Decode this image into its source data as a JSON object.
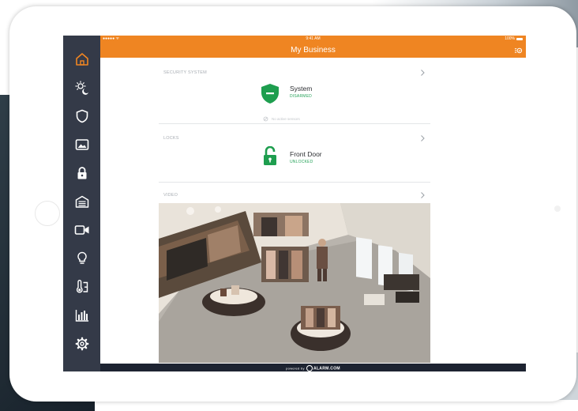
{
  "status_bar": {
    "signal": "●●●●● ᯤ",
    "time": "9:41 AM",
    "battery": "100%"
  },
  "header": {
    "title": "My Business",
    "action_icon": "scene-settings-icon"
  },
  "sidebar": {
    "items": [
      {
        "name": "home",
        "icon": "home-icon",
        "active": true
      },
      {
        "name": "scenes",
        "icon": "sun-moon-icon"
      },
      {
        "name": "security",
        "icon": "shield-icon"
      },
      {
        "name": "images",
        "icon": "image-icon"
      },
      {
        "name": "locks",
        "icon": "lock-icon"
      },
      {
        "name": "garage",
        "icon": "garage-icon"
      },
      {
        "name": "video",
        "icon": "video-camera-icon"
      },
      {
        "name": "lights",
        "icon": "light-bulb-icon"
      },
      {
        "name": "thermostat",
        "icon": "thermostat-icon"
      },
      {
        "name": "energy",
        "icon": "bar-chart-icon"
      },
      {
        "name": "settings",
        "icon": "gear-icon"
      }
    ]
  },
  "security": {
    "section_label": "SECURITY SYSTEM",
    "name": "System",
    "status": "DISARMED",
    "note": "No active sensors"
  },
  "locks": {
    "section_label": "LOCKS",
    "name": "Front Door",
    "status": "UNLOCKED"
  },
  "video": {
    "section_label": "VIDEO"
  },
  "footer": {
    "powered_by": "powered by",
    "brand": "ALARM.COM"
  },
  "colors": {
    "header": "#ef8522",
    "sidebar": "#343a48",
    "active_icon": "#ef8522",
    "status_green": "#27a35a",
    "footer": "#1d2331"
  }
}
